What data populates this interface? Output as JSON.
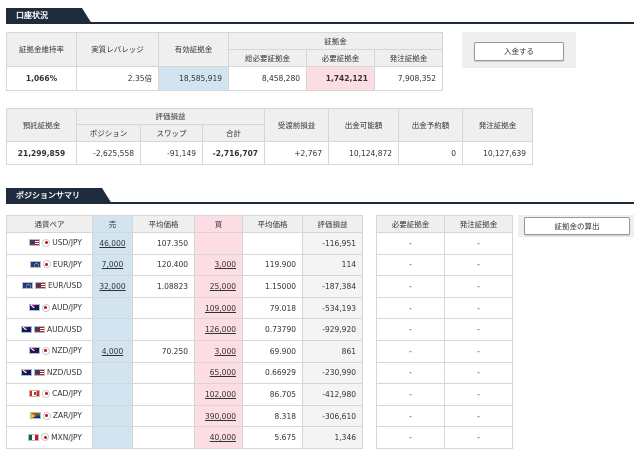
{
  "account": {
    "title": "口座状況",
    "summary": {
      "headers": [
        "証拠金維持率",
        "実質レバレッジ",
        "有効証拠金"
      ],
      "group_header": "証拠金",
      "sub_headers": [
        "総必要証拠金",
        "必要証拠金",
        "発注証拠金"
      ],
      "values": [
        "1,066%",
        "2.35倍",
        "18,585,919",
        "8,458,280",
        "1,742,121",
        "7,908,352"
      ]
    },
    "deposit_button": "入金する",
    "balance": {
      "headers": [
        "預託証拠金",
        "受渡前損益",
        "出金可能額",
        "出金予約額",
        "発注証拠金"
      ],
      "group_header": "評価損益",
      "sub_headers": [
        "ポジション",
        "スワップ",
        "合計"
      ],
      "values": [
        "21,299,859",
        "-2,625,558",
        "-91,149",
        "-2,716,707",
        "+2,767",
        "10,124,872",
        "0",
        "10,127,639"
      ]
    }
  },
  "positions": {
    "title": "ポジションサマリ",
    "headers": [
      "通貨ペア",
      "売",
      "平均価格",
      "買",
      "平均価格",
      "評価損益"
    ],
    "margin_headers": [
      "必要証拠金",
      "発注証拠金"
    ],
    "calc_button": "証拠金の算出",
    "rows": [
      {
        "flags": [
          "us",
          "jp"
        ],
        "pair": "USD/JPY",
        "sell": "46,000",
        "sell_avg": "107.350",
        "buy": "",
        "buy_avg": "",
        "pl": "-116,951",
        "req": "-",
        "order": "-"
      },
      {
        "flags": [
          "eu",
          "jp"
        ],
        "pair": "EUR/JPY",
        "sell": "7,000",
        "sell_avg": "120.400",
        "buy": "3,000",
        "buy_avg": "119.900",
        "pl": "114",
        "req": "-",
        "order": "-"
      },
      {
        "flags": [
          "eu",
          "us"
        ],
        "pair": "EUR/USD",
        "sell": "32,000",
        "sell_avg": "1.08823",
        "buy": "25,000",
        "buy_avg": "1.15000",
        "pl": "-187,384",
        "req": "-",
        "order": "-"
      },
      {
        "flags": [
          "au",
          "jp"
        ],
        "pair": "AUD/JPY",
        "sell": "",
        "sell_avg": "",
        "buy": "109,000",
        "buy_avg": "79.018",
        "pl": "-534,193",
        "req": "-",
        "order": "-"
      },
      {
        "flags": [
          "au",
          "us"
        ],
        "pair": "AUD/USD",
        "sell": "",
        "sell_avg": "",
        "buy": "126,000",
        "buy_avg": "0.73790",
        "pl": "-929,920",
        "req": "-",
        "order": "-"
      },
      {
        "flags": [
          "nz",
          "jp"
        ],
        "pair": "NZD/JPY",
        "sell": "4,000",
        "sell_avg": "70.250",
        "buy": "3,000",
        "buy_avg": "69.900",
        "pl": "861",
        "req": "-",
        "order": "-"
      },
      {
        "flags": [
          "nz",
          "us"
        ],
        "pair": "NZD/USD",
        "sell": "",
        "sell_avg": "",
        "buy": "65,000",
        "buy_avg": "0.66929",
        "pl": "-230,990",
        "req": "-",
        "order": "-"
      },
      {
        "flags": [
          "ca",
          "jp"
        ],
        "pair": "CAD/JPY",
        "sell": "",
        "sell_avg": "",
        "buy": "102,000",
        "buy_avg": "86.705",
        "pl": "-412,980",
        "req": "-",
        "order": "-"
      },
      {
        "flags": [
          "za",
          "jp"
        ],
        "pair": "ZAR/JPY",
        "sell": "",
        "sell_avg": "",
        "buy": "390,000",
        "buy_avg": "8.318",
        "pl": "-306,610",
        "req": "-",
        "order": "-"
      },
      {
        "flags": [
          "mx",
          "jp"
        ],
        "pair": "MXN/JPY",
        "sell": "",
        "sell_avg": "",
        "buy": "40,000",
        "buy_avg": "5.675",
        "pl": "1,346",
        "req": "-",
        "order": "-"
      }
    ]
  },
  "colors": {
    "header_dark": "#1e2b3c",
    "sell_bg": "#d3e4f1",
    "buy_bg": "#fbdde3",
    "header_bg": "#efefef"
  }
}
